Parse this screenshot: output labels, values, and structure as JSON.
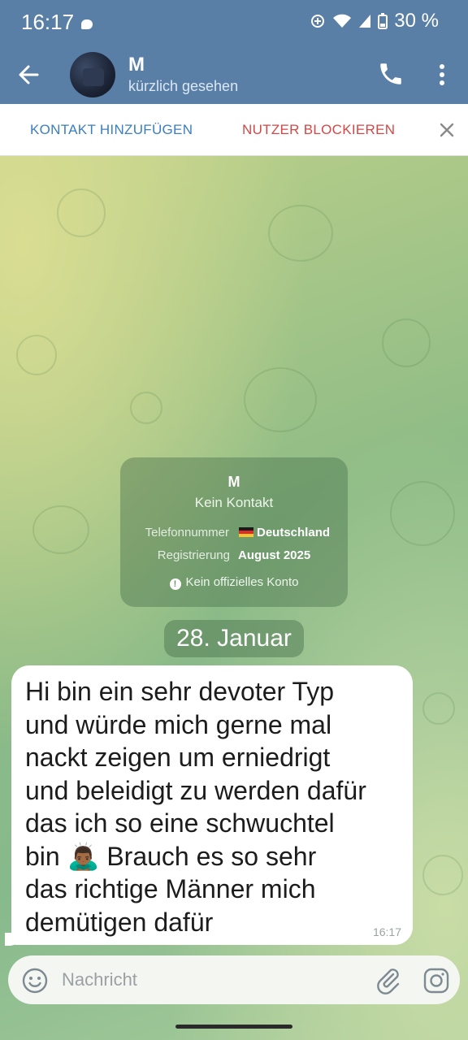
{
  "status_bar": {
    "time": "16:17",
    "battery": "30 %"
  },
  "header": {
    "name": "M",
    "status": "kürzlich gesehen"
  },
  "action_bar": {
    "add_contact": "KONTAKT HINZUFÜGEN",
    "block_user": "NUTZER BLOCKIEREN"
  },
  "info_card": {
    "name": "M",
    "subtitle": "Kein Kontakt",
    "phone_label": "Telefonnummer",
    "phone_value": "Deutschland",
    "registered_label": "Registrierung",
    "registered_value": "August 2025",
    "official_note": "Kein offizielles Konto"
  },
  "date_separator": "28. Januar",
  "message": {
    "lines": [
      "Hi bin ein sehr devoter Typ",
      "und würde mich gerne mal",
      "nackt zeigen um erniedrigt",
      "und beleidigt zu werden dafür",
      "das ich so eine schwuchtel",
      "bin 🙇🏾‍♂️ Brauch es so sehr",
      "das richtige Männer mich",
      "demütigen dafür"
    ],
    "time": "16:17"
  },
  "composer": {
    "placeholder": "Nachricht"
  },
  "icons": {
    "back": "arrow-left-icon",
    "call": "phone-icon",
    "menu": "more-vert-icon",
    "close": "close-icon",
    "emoji": "smiley-icon",
    "attach": "paperclip-icon",
    "camera": "instagram-camera-icon"
  },
  "colors": {
    "header_bg": "#5a7fa6",
    "add_contact": "#3a7fbf",
    "block_user": "#d54747"
  }
}
